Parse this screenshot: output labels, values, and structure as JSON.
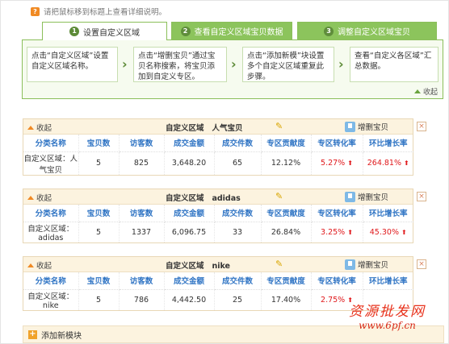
{
  "hint": {
    "badge": "?",
    "text": "请把鼠标移到标题上查看详细说明。"
  },
  "tabs": [
    {
      "num": "1",
      "label": "设置自定义区域"
    },
    {
      "num": "2",
      "label": "查看自定义区域宝贝数据"
    },
    {
      "num": "3",
      "label": "调整自定义区域宝贝"
    }
  ],
  "steps": [
    "点击“自定义区域”设置自定义区域名称。",
    "点击“增删宝贝”通过宝贝名称搜索，将宝贝添加到自定义专区。",
    "点击“添加新模”块设置多个自定义区域重复此步骤。",
    "查看“自定义各区域”汇总数据。"
  ],
  "collapse_label": "收起",
  "module_common": {
    "toggle_label": "收起",
    "title_prefix": "自定义区域",
    "add_label": "增删宝贝",
    "close_label": "×",
    "columns": [
      "分类名称",
      "宝贝数",
      "访客数",
      "成交金额",
      "成交件数",
      "专区贡献度",
      "专区转化率",
      "环比增长率"
    ]
  },
  "modules": [
    {
      "name": "人气宝贝",
      "row": [
        "自定义区域：人气宝贝",
        "5",
        "825",
        "3,648.20",
        "65",
        "12.12%",
        "5.27%",
        "264.81%"
      ],
      "conv_up": true,
      "growth_up": true
    },
    {
      "name": "adidas",
      "row": [
        "自定义区域：adidas",
        "5",
        "1337",
        "6,096.75",
        "33",
        "26.84%",
        "3.25%",
        "45.30%"
      ],
      "conv_up": true,
      "growth_up": true
    },
    {
      "name": "nike",
      "row": [
        "自定义区域：nike",
        "5",
        "786",
        "4,442.50",
        "25",
        "17.40%",
        "2.75%",
        ""
      ],
      "conv_up": true,
      "growth_up": false
    }
  ],
  "add_module_label": "添加新模块",
  "watermark": {
    "line1": "资源批发网",
    "line2": "www.6pf.cn"
  },
  "icons": {
    "up_arrow": "⬆",
    "edit": "✎"
  },
  "colors": {
    "green_tab": "#8cc45c",
    "header_blue": "#2f74c4",
    "accent_red": "#e0181b",
    "orange": "#f08a24"
  }
}
